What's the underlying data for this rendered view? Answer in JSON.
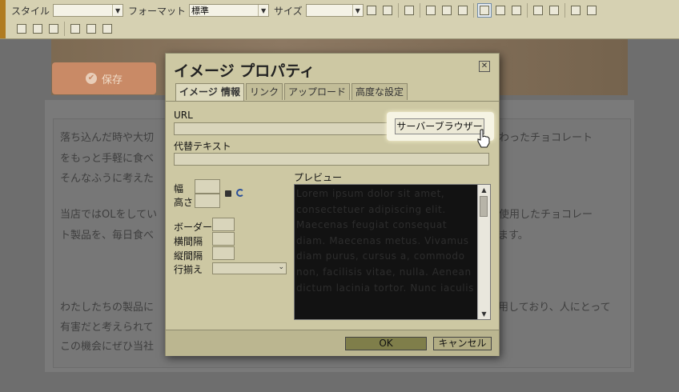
{
  "toolbar": {
    "style_label": "スタイル",
    "format_label": "フォーマット",
    "format_value": "標準",
    "size_label": "サイズ",
    "style_value": "",
    "size_value": ""
  },
  "page": {
    "save_label": "保存",
    "left_lines": [
      "落ち込んだ時や大切",
      "をもっと手軽に食べ",
      "そんなふうに考えた",
      "当店ではOLをしてい",
      "ト製品を、毎日食べ",
      "わたしたちの製品に",
      "有害だと考えられて",
      "この機会にぜひ当社"
    ],
    "right_lines": [
      "だわったチョコレート",
      "み使用したチョコレー",
      "ます。",
      "用しており、人にとって"
    ]
  },
  "dialog": {
    "title": "イメージ プロパティ",
    "close_glyph": "✕",
    "tabs": [
      {
        "label": "イメージ 情報",
        "active": true
      },
      {
        "label": "リンク",
        "active": false
      },
      {
        "label": "アップロード",
        "active": false
      },
      {
        "label": "高度な設定",
        "active": false
      }
    ],
    "url_label": "URL",
    "url_value": "",
    "server_browse_label": "サーバーブラウザー",
    "alt_label": "代替テキスト",
    "alt_value": "",
    "width_label": "幅",
    "height_label": "高さ",
    "border_label": "ボーダー",
    "hspace_label": "横間隔",
    "vspace_label": "縦間隔",
    "align_label": "行揃え",
    "align_value": "",
    "preview_label": "プレビュー",
    "preview_text": "Lorem ipsum dolor sit amet, consectetuer adipiscing elit. Maecenas feugiat consequat diam. Maecenas metus. Vivamus diam purus, cursus a, commodo non, facilisis vitae, nulla. Aenean dictum lacinia tortor. Nunc iaculis",
    "ok_label": "OK",
    "cancel_label": "キャンセル"
  }
}
